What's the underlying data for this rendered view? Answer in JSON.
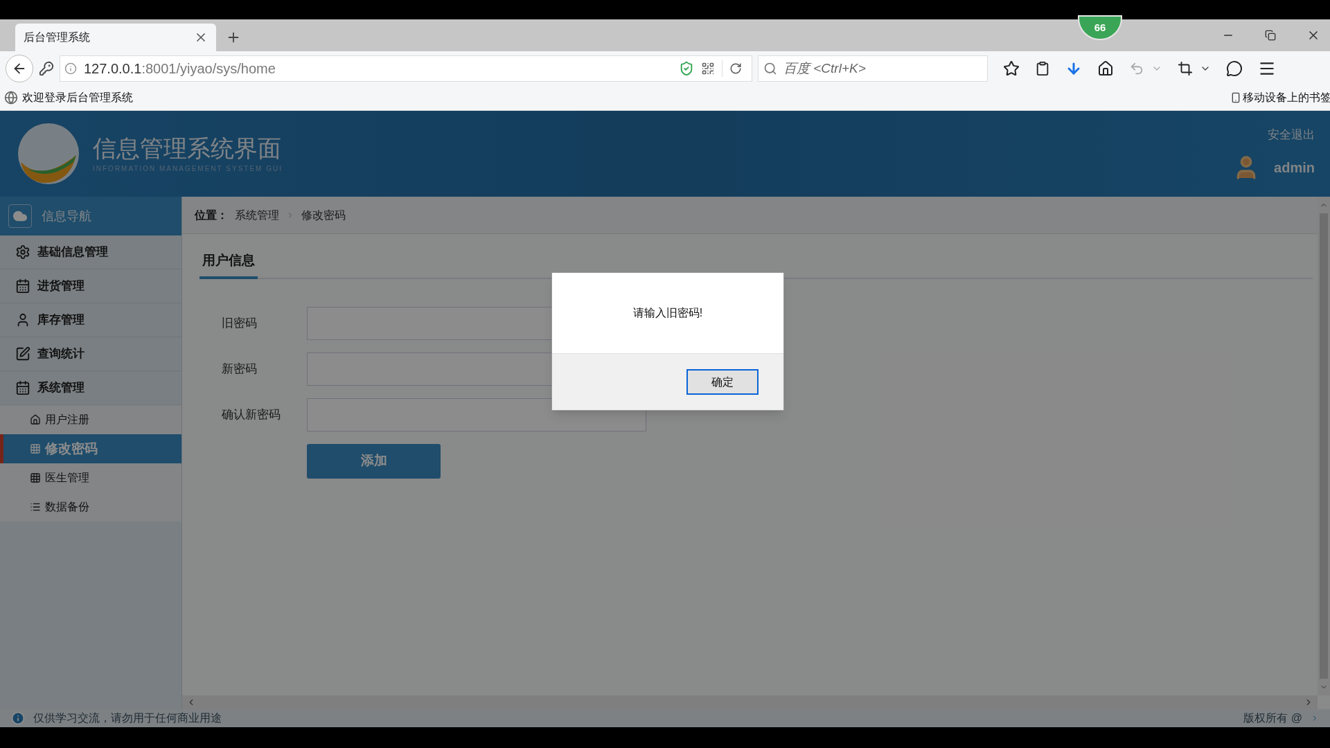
{
  "browser": {
    "tab_title": "后台管理系统",
    "badge": "66",
    "url_host": "127.0.0.1",
    "url_rest": ":8001/yiyao/sys/home",
    "search_placeholder": "百度 <Ctrl+K>",
    "bookmark": "欢迎登录后台管理系统",
    "mobile_bookmarks": "移动设备上的书签"
  },
  "header": {
    "title": "信息管理系统界面",
    "subtitle": "INFORMATION MANAGEMENT SYSTEM GUI",
    "logout": "安全退出",
    "user": "admin"
  },
  "sidebar": {
    "heading": "信息导航",
    "items": [
      {
        "label": "基础信息管理"
      },
      {
        "label": "进货管理"
      },
      {
        "label": "库存管理"
      },
      {
        "label": "查询统计"
      },
      {
        "label": "系统管理",
        "children": [
          {
            "label": "用户注册",
            "selected": false
          },
          {
            "label": "修改密码",
            "selected": true
          },
          {
            "label": "医生管理",
            "selected": false
          },
          {
            "label": "数据备份",
            "selected": false
          }
        ]
      }
    ]
  },
  "breadcrumb": {
    "label": "位置：",
    "items": [
      "系统管理",
      "修改密码"
    ]
  },
  "section_tab": "用户信息",
  "form": {
    "fields": [
      {
        "label": "旧密码"
      },
      {
        "label": "新密码"
      },
      {
        "label": "确认新密码"
      }
    ],
    "submit": "添加"
  },
  "dialog": {
    "message": "请输入旧密码!",
    "button": "确定"
  },
  "footer": {
    "notice": "仅供学习交流，请勿用于任何商业用途",
    "copyright": "版权所有 @"
  }
}
